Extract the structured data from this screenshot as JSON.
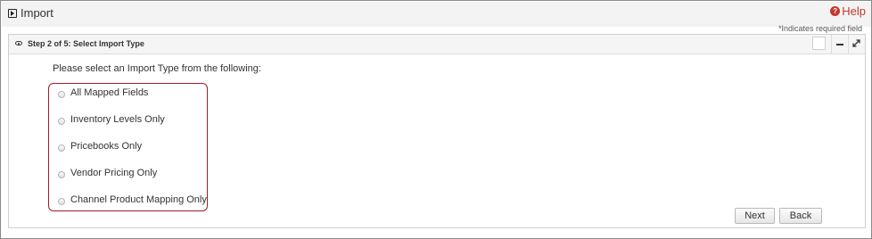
{
  "window": {
    "title": "Import",
    "help_label": "Help",
    "required_note": "*Indicates required field"
  },
  "panel": {
    "step_title": "Step 2 of 5: Select Import Type",
    "prompt": "Please select an Import Type from the following:",
    "options": [
      {
        "label": "All Mapped Fields",
        "selected": false
      },
      {
        "label": "Inventory Levels Only",
        "selected": false
      },
      {
        "label": "Pricebooks Only",
        "selected": false
      },
      {
        "label": "Vendor Pricing Only",
        "selected": false
      },
      {
        "label": "Channel Product Mapping Only",
        "selected": false
      }
    ],
    "next_label": "Next",
    "back_label": "Back"
  },
  "colors": {
    "help": "#c0392b",
    "highlight_border": "#a01d2b",
    "header_bg": "#f5f5f5"
  },
  "icons": {
    "app": "import-window-icon",
    "help": "question-circle-icon",
    "panel": "eye-icon",
    "minimize": "minus-icon",
    "expand": "expand-arrows-icon"
  }
}
